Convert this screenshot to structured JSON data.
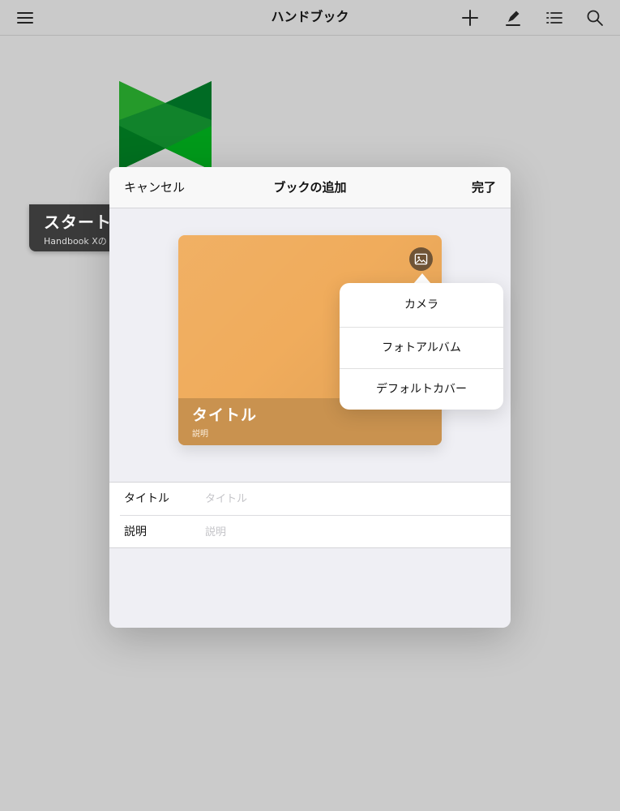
{
  "navbar": {
    "title": "ハンドブック",
    "icons": [
      "hamburger-menu-icon",
      "plus-icon",
      "pencil-icon",
      "list-icon",
      "search-icon"
    ]
  },
  "background_book": {
    "title": "スタートア",
    "subtitle": "Handbook Xの",
    "cover_colors": [
      "#259a2a",
      "#006b24",
      "#11832b",
      "#00701f"
    ]
  },
  "sheet": {
    "cancel_label": "キャンセル",
    "title": "ブックの追加",
    "done_label": "完了",
    "cover": {
      "title": "タイトル",
      "description": "説明",
      "color": "#f0ac5c",
      "band_color": "#c9924f",
      "image_button_icon": "image-icon"
    },
    "form": {
      "title_label": "タイトル",
      "title_value": "",
      "title_placeholder": "タイトル",
      "description_label": "説明",
      "description_value": "",
      "description_placeholder": "説明"
    }
  },
  "popover": {
    "items": [
      {
        "label": "カメラ"
      },
      {
        "label": "フォトアルバム"
      },
      {
        "label": "デフォルトカバー"
      }
    ]
  }
}
